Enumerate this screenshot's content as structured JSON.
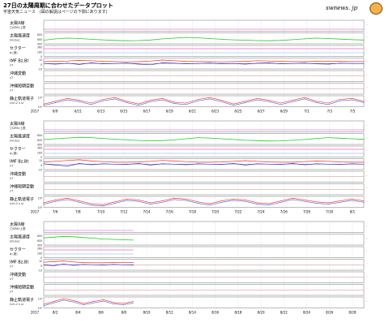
{
  "header": {
    "title": "27日の太陽周期に合わせたデータプロット",
    "subtitle": "宇宙天気ニュース　(図の解説はページの下側にあります)",
    "logo_text": "swnews. jp"
  },
  "chart_data": {
    "type": "line",
    "row_labels": [
      {
        "main": "太陽X線",
        "sub": "〇IZMU上限"
      },
      {
        "main": "太陽風速度",
        "sub": "km/sec"
      },
      {
        "main": "セクター",
        "sub": "φ (度)"
      },
      {
        "main": "IMF Bz,Bt",
        "sub": "nT"
      },
      {
        "main": "沖縄変動",
        "sub": "nT"
      },
      {
        "main": "沖縄短期変動",
        "sub": "nT"
      },
      {
        "main": "静止軌道電子",
        "sub": "/cm-2 s sr"
      }
    ],
    "row_ticks": [
      [
        "",
        ""
      ],
      [
        "800",
        "600",
        "400"
      ],
      [
        "360",
        "180",
        "0"
      ],
      [
        "10",
        "0",
        "-10"
      ],
      [
        "",
        ""
      ],
      [
        "",
        ""
      ],
      [
        "10⁸",
        "10⁶"
      ]
    ],
    "axis_year": "2017",
    "panels": [
      {
        "x_labels": [
          "6/9",
          "6/11",
          "6/13",
          "6/15",
          "6/17",
          "6/19",
          "6/21",
          "6/23",
          "6/25",
          "6/27",
          "6/29",
          "7/1",
          "7/3",
          "7/5"
        ],
        "speed": [
          450,
          520,
          560,
          540,
          500,
          470,
          440,
          420,
          430,
          460,
          520,
          560,
          600,
          580,
          540,
          500,
          470,
          450,
          430,
          420,
          440,
          480,
          520,
          560,
          540,
          510,
          480,
          460
        ],
        "bt": [
          6,
          7,
          8,
          10,
          9,
          7,
          6,
          5,
          6,
          8,
          11,
          9,
          7,
          6,
          6,
          5,
          6,
          7,
          9,
          8,
          7,
          6,
          6,
          7,
          8,
          7,
          6,
          6
        ],
        "bz": [
          0,
          -2,
          1,
          -3,
          2,
          -1,
          0,
          1,
          -2,
          -4,
          2,
          1,
          -1,
          0,
          1,
          -1,
          0,
          -2,
          1,
          2,
          -1,
          0,
          1,
          -1,
          -2,
          1,
          0,
          0
        ],
        "electron": [
          0.2,
          0.5,
          0.8,
          0.6,
          0.3,
          0.7,
          0.9,
          0.5,
          0.2,
          0.6,
          0.8,
          0.4,
          0.3,
          0.7,
          0.9,
          0.6,
          0.2,
          0.5,
          0.8,
          0.6,
          0.3,
          0.6,
          0.9,
          0.5,
          0.3,
          0.7,
          0.8,
          0.5
        ]
      },
      {
        "x_labels": [
          "7/6",
          "7/8",
          "7/10",
          "7/12",
          "7/14",
          "7/16",
          "7/18",
          "7/20",
          "7/22",
          "7/24",
          "7/26",
          "7/28",
          "7/30",
          "8/1"
        ],
        "speed": [
          520,
          560,
          600,
          640,
          620,
          580,
          540,
          500,
          470,
          450,
          460,
          500,
          560,
          620,
          600,
          560,
          520,
          480,
          460,
          440,
          450,
          480,
          520,
          580,
          620,
          590,
          560,
          530
        ],
        "bt": [
          7,
          9,
          12,
          14,
          10,
          8,
          6,
          6,
          7,
          9,
          12,
          10,
          8,
          6,
          6,
          7,
          9,
          11,
          9,
          7,
          6,
          6,
          8,
          10,
          9,
          7,
          6,
          6
        ],
        "bz": [
          1,
          -3,
          -6,
          2,
          -2,
          1,
          0,
          -1,
          2,
          -3,
          1,
          0,
          -2,
          1,
          0,
          -1,
          2,
          -3,
          1,
          0,
          -1,
          2,
          -2,
          1,
          0,
          -1,
          1,
          0
        ],
        "electron": [
          0.4,
          0.7,
          0.9,
          0.6,
          0.3,
          0.2,
          0.5,
          0.8,
          0.7,
          0.4,
          0.6,
          0.9,
          0.8,
          0.5,
          0.3,
          0.6,
          0.8,
          0.7,
          0.4,
          0.3,
          0.6,
          0.9,
          0.7,
          0.5,
          0.4,
          0.6,
          0.8,
          0.6
        ]
      },
      {
        "x_labels": [
          "8/2",
          "8/4",
          "8/6",
          "8/8",
          "8/10",
          "8/12",
          "8/14",
          "8/16",
          "8/18",
          "8/20",
          "8/22",
          "8/24",
          "8/26",
          "8/28"
        ],
        "speed": [
          640,
          680,
          720,
          700,
          660,
          620,
          580,
          560,
          540,
          520
        ],
        "bt": [
          8,
          10,
          12,
          9,
          7,
          6,
          6,
          7,
          8,
          7
        ],
        "bz": [
          -1,
          -3,
          2,
          -2,
          1,
          0,
          -1,
          1,
          0,
          -1
        ],
        "electron": [
          0.3,
          0.6,
          0.9,
          0.7,
          0.4,
          0.6,
          0.8,
          0.5,
          0.4,
          0.6
        ]
      }
    ],
    "colors": {
      "xray": "#cc44cc",
      "speed": "#22cc22",
      "sector": "#ff9fd0",
      "sector_alt": "#99ccee",
      "bt": "#ff2222",
      "bz": "#2233cc",
      "electron_red": "#ff2222",
      "electron_blue": "#2233cc",
      "zeroline": "#cc6666"
    },
    "grid": true
  }
}
